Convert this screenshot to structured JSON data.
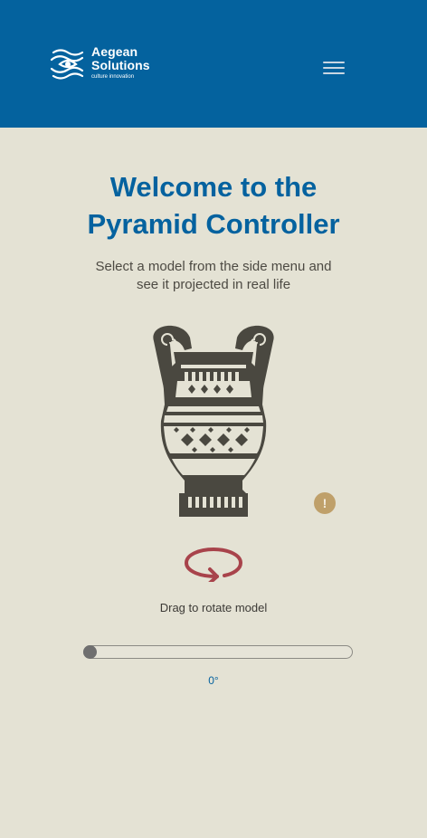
{
  "header": {
    "logo": {
      "line1": "Aegean",
      "line2": "Solutions",
      "tagline": "culture innovation",
      "icon": "eye-waves-icon"
    },
    "menu_icon": "hamburger-menu-icon",
    "background": "#04629e"
  },
  "main": {
    "title_line1": "Welcome to the",
    "title_line2": "Pyramid Controller",
    "subtitle_line1": "Select a model from the side menu and",
    "subtitle_line2": "see it projected in real life",
    "model_image": "greek-amphora-vase",
    "info_icon": "exclamation-icon",
    "info_glyph": "!",
    "rotate_icon": "rotate-arrow-icon",
    "rotate_label": "Drag to rotate model",
    "slider": {
      "value_fraction": 0
    },
    "degree_readout": "0°"
  },
  "colors": {
    "accent_blue": "#05629f",
    "background": "#e4e2d4",
    "rotate_red": "#a8434b",
    "info_gold": "#bfa06a",
    "vase_dark": "#4a4840"
  }
}
